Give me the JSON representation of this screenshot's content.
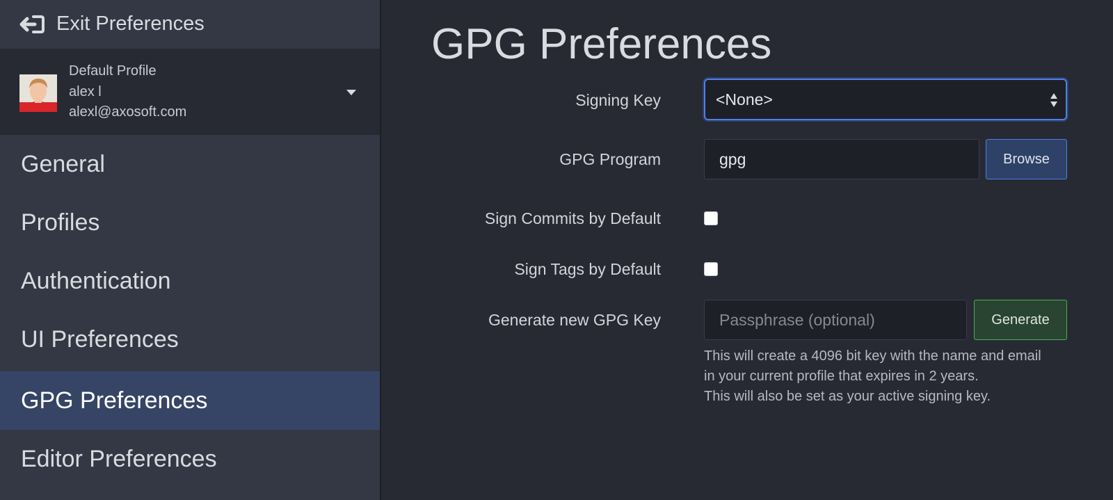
{
  "sidebar": {
    "exit_label": "Exit Preferences",
    "profile": {
      "name": "Default Profile",
      "username": "alex l",
      "email": "alexl@axosoft.com"
    },
    "items": [
      {
        "label": "General",
        "active": false
      },
      {
        "label": "Profiles",
        "active": false
      },
      {
        "label": "Authentication",
        "active": false
      },
      {
        "label": "UI Preferences",
        "active": false
      },
      {
        "label": "GPG Preferences",
        "active": true
      },
      {
        "label": "Editor Preferences",
        "active": false
      }
    ]
  },
  "main": {
    "title": "GPG Preferences",
    "signing_key": {
      "label": "Signing Key",
      "value": "<None>"
    },
    "gpg_program": {
      "label": "GPG Program",
      "value": "gpg",
      "browse_label": "Browse"
    },
    "sign_commits": {
      "label": "Sign Commits by Default",
      "checked": false
    },
    "sign_tags": {
      "label": "Sign Tags by Default",
      "checked": false
    },
    "generate_key": {
      "label": "Generate new GPG Key",
      "placeholder": "Passphrase (optional)",
      "button_label": "Generate",
      "help_lines": [
        "This will create a 4096 bit key with the name and email",
        "in your current profile that expires in 2 years.",
        "This will also be set as your active signing key."
      ]
    }
  },
  "colors": {
    "sidebar_bg": "#343844",
    "main_bg": "#272a33",
    "active_item_bg": "#364566",
    "focus_accent": "#4d7ff0",
    "generate_accent": "#4caf50"
  },
  "icons": {
    "exit": "exit-arrow-icon",
    "profile_dropdown": "caret-down-icon",
    "select_arrows": "select-arrows-icon"
  }
}
